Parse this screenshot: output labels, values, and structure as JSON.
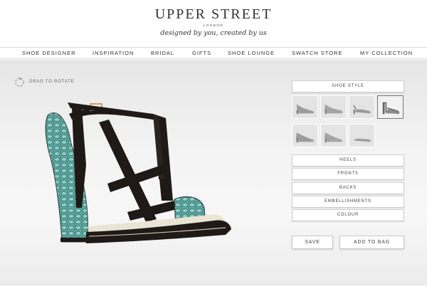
{
  "brand": {
    "name": "UPPER STREET",
    "location": "LONDON",
    "tagline": "designed by you, created by us"
  },
  "nav": [
    "SHOE DESIGNER",
    "INSPIRATION",
    "BRIDAL",
    "GIFTS",
    "SHOE LOUNGE",
    "SWATCH STORE",
    "MY COLLECTION"
  ],
  "stage": {
    "rotate_label": "DRAG TO ROTATE"
  },
  "panel": {
    "shoe_style_label": "SHOE STYLE",
    "options": [
      "HEELS",
      "FRONTS",
      "BACKS",
      "EMBELLISHMENTS",
      "COLOUR"
    ],
    "save_label": "SAVE",
    "add_to_bag_label": "ADD TO BAG"
  },
  "colors": {
    "strap": "#1f1a17",
    "heel_pattern": "#5fa9a3",
    "sole_edge": "#cfc3a8"
  }
}
